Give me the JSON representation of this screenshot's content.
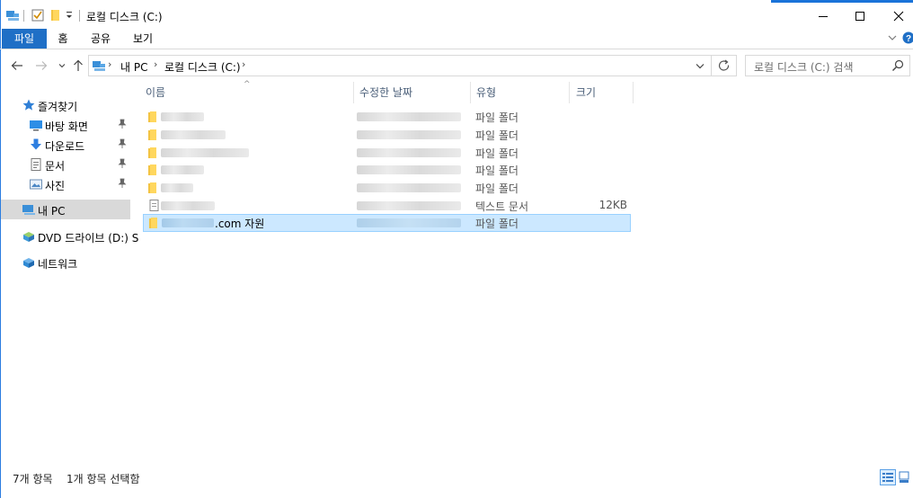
{
  "window": {
    "title": "로컬 디스크 (C:)",
    "accent_color": "#1f6fc6"
  },
  "ribbon": {
    "tabs": [
      "파일",
      "홈",
      "공유",
      "보기"
    ]
  },
  "address": {
    "segments": [
      "내 PC",
      "로컬 디스크 (C:)"
    ],
    "search_placeholder": "로컬 디스크 (C:) 검색"
  },
  "navpane": {
    "quick_access": "즐겨찾기",
    "pinned": [
      "바탕 화면",
      "다운로드",
      "문서",
      "사진"
    ],
    "this_pc": "내 PC",
    "dvd": "DVD 드라이브 (D:) S",
    "network": "네트워크"
  },
  "columns": {
    "name": "이름",
    "date": "수정한 날짜",
    "type": "유형",
    "size": "크기"
  },
  "files": [
    {
      "type": "파일 폴더",
      "size": "",
      "kind": "folder"
    },
    {
      "type": "파일 폴더",
      "size": "",
      "kind": "folder"
    },
    {
      "type": "파일 폴더",
      "size": "",
      "kind": "folder"
    },
    {
      "type": "파일 폴더",
      "size": "",
      "kind": "folder"
    },
    {
      "type": "파일 폴더",
      "size": "",
      "kind": "folder"
    },
    {
      "type": "텍스트 문서",
      "size": "12KB",
      "kind": "text"
    },
    {
      "name_suffix": ".com 자원",
      "type": "파일 폴더",
      "size": "",
      "kind": "folder",
      "selected": true
    }
  ],
  "status": {
    "count": "7개 항목",
    "selection": "1개 항목 선택함"
  }
}
